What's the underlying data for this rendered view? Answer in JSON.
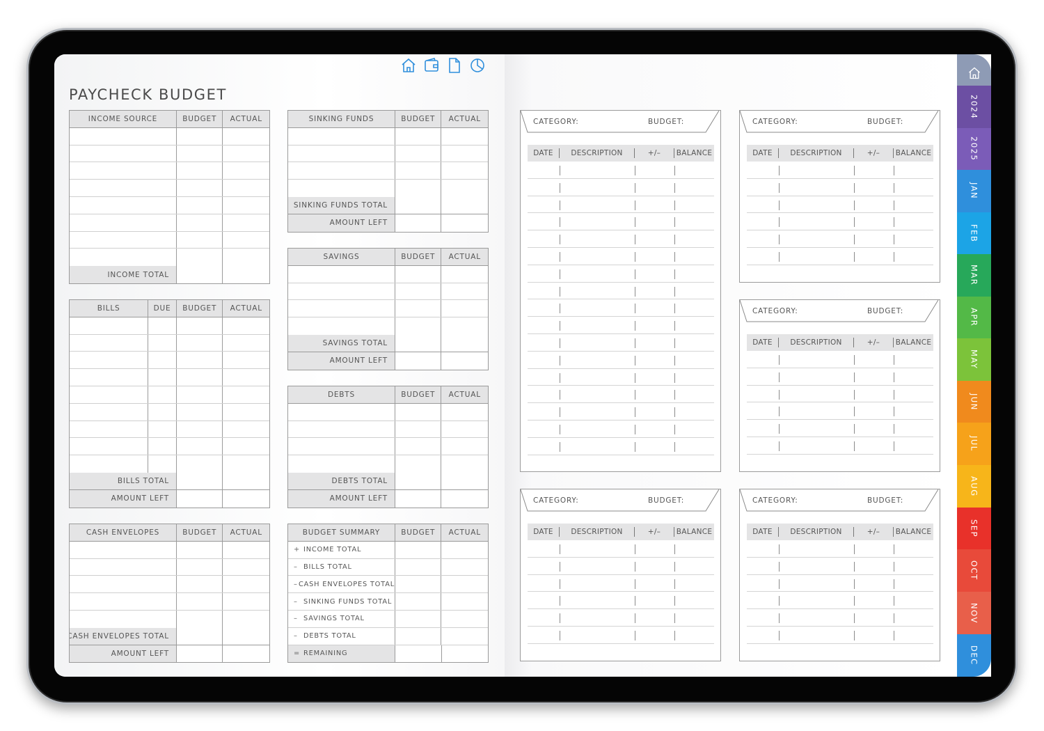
{
  "page": {
    "title": "PAYCHECK BUDGET"
  },
  "nav_icons": [
    "home-icon",
    "wallet-icon",
    "document-icon",
    "pie-chart-icon"
  ],
  "headers": {
    "budget": "BUDGET",
    "actual": "ACTUAL",
    "due": "DUE"
  },
  "income": {
    "title": "INCOME SOURCE",
    "total": "INCOME TOTAL",
    "rows": 8
  },
  "bills": {
    "title": "BILLS",
    "total": "BILLS TOTAL",
    "left": "AMOUNT LEFT",
    "rows": 9
  },
  "cash": {
    "title": "CASH ENVELOPES",
    "total": "CASH ENVELOPES TOTAL",
    "left": "AMOUNT LEFT",
    "rows": 5
  },
  "sinking": {
    "title": "SINKING FUNDS",
    "total": "SINKING FUNDS TOTAL",
    "left": "AMOUNT LEFT",
    "rows": 4
  },
  "savings": {
    "title": "SAVINGS",
    "total": "SAVINGS TOTAL",
    "left": "AMOUNT LEFT",
    "rows": 4
  },
  "debts": {
    "title": "DEBTS",
    "total": "DEBTS TOTAL",
    "left": "AMOUNT LEFT",
    "rows": 4
  },
  "summary": {
    "title": "BUDGET SUMMARY",
    "items": [
      {
        "sign": "+",
        "label": "INCOME TOTAL"
      },
      {
        "sign": "–",
        "label": "BILLS TOTAL"
      },
      {
        "sign": "–",
        "label": "CASH ENVELOPES TOTAL"
      },
      {
        "sign": "–",
        "label": "SINKING FUNDS TOTAL"
      },
      {
        "sign": "–",
        "label": "SAVINGS TOTAL"
      },
      {
        "sign": "–",
        "label": "DEBTS TOTAL"
      },
      {
        "sign": "=",
        "label": "REMAINING"
      }
    ]
  },
  "tracker": {
    "category_label": "CATEGORY:",
    "budget_label": "BUDGET:",
    "columns": [
      "DATE",
      "DESCRIPTION",
      "+/–",
      "BALANCE"
    ]
  },
  "tabs": [
    {
      "label": "",
      "icon": "home-icon",
      "color": "#8e9bb5"
    },
    {
      "label": "2024",
      "color": "#6c4fa3"
    },
    {
      "label": "2025",
      "color": "#7b5cb8"
    },
    {
      "label": "JAN",
      "color": "#2f8fdc"
    },
    {
      "label": "FEB",
      "color": "#1ca4e6"
    },
    {
      "label": "MAR",
      "color": "#27a85a"
    },
    {
      "label": "APR",
      "color": "#53b947"
    },
    {
      "label": "MAY",
      "color": "#7cc33a"
    },
    {
      "label": "JUN",
      "color": "#f08a1d"
    },
    {
      "label": "JUL",
      "color": "#f6a21a"
    },
    {
      "label": "AUG",
      "color": "#f7b51a"
    },
    {
      "label": "SEP",
      "color": "#e8312a"
    },
    {
      "label": "OCT",
      "color": "#e84a3a"
    },
    {
      "label": "NOV",
      "color": "#e85f4a"
    },
    {
      "label": "DEC",
      "color": "#2f8fdc"
    }
  ]
}
